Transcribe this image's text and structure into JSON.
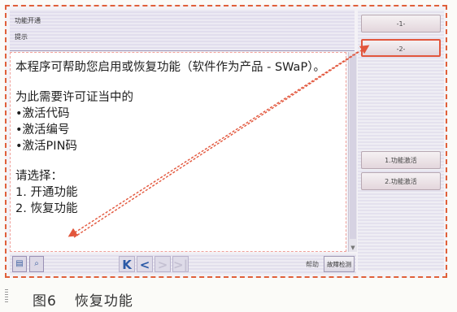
{
  "header": {
    "title": "功能开通",
    "subtitle": "提示"
  },
  "content": {
    "intro": "本程序可帮助您启用或恢复功能（软件作为产品 - SWaP）。",
    "requirement_title": "为此需要许可证当中的",
    "requirements": [
      "•激活代码",
      "•激活编号",
      "•激活PIN码"
    ],
    "choose_label": "请选择：",
    "options": [
      "1. 开通功能",
      "2. 恢复功能"
    ]
  },
  "side_panel": {
    "top_buttons": [
      "-1-",
      "-2-"
    ],
    "option_buttons": [
      "1.功能激活",
      "2.功能激活"
    ]
  },
  "bottom_bar": {
    "icons": [
      "print-icon",
      "zoom-icon"
    ],
    "nav": {
      "first": "K",
      "prev": "<",
      "next": ">",
      "last": ">|"
    },
    "help_label": "帮助",
    "query_label": "故障检测"
  },
  "caption": {
    "label": "图6",
    "title": "恢复功能"
  },
  "colors": {
    "highlight": "#e2563c",
    "nav_enabled": "#2b5aa6"
  }
}
